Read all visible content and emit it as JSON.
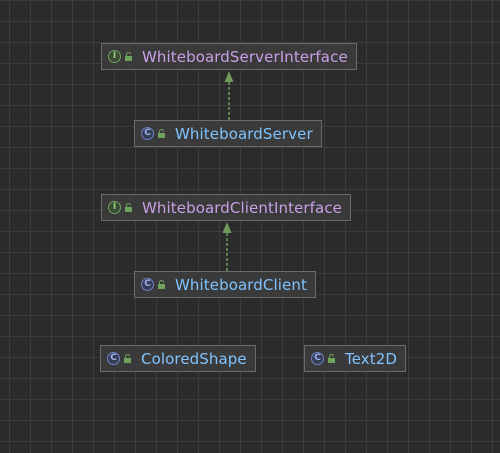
{
  "diagram": {
    "nodes": [
      {
        "id": "WhiteboardServerInterface",
        "kind": "interface",
        "kind_icon": "interface-icon",
        "kind_glyph": "I",
        "label": "WhiteboardServerInterface"
      },
      {
        "id": "WhiteboardServer",
        "kind": "class",
        "kind_icon": "class-icon",
        "kind_glyph": "C",
        "label": "WhiteboardServer"
      },
      {
        "id": "WhiteboardClientInterface",
        "kind": "interface",
        "kind_icon": "interface-icon",
        "kind_glyph": "I",
        "label": "WhiteboardClientInterface"
      },
      {
        "id": "WhiteboardClient",
        "kind": "class",
        "kind_icon": "class-icon",
        "kind_glyph": "C",
        "label": "WhiteboardClient"
      },
      {
        "id": "ColoredShape",
        "kind": "class",
        "kind_icon": "class-icon",
        "kind_glyph": "C",
        "label": "ColoredShape"
      },
      {
        "id": "Text2D",
        "kind": "class",
        "kind_icon": "class-icon",
        "kind_glyph": "C",
        "label": "Text2D"
      }
    ],
    "edges": [
      {
        "from": "WhiteboardServer",
        "to": "WhiteboardServerInterface",
        "type": "implements"
      },
      {
        "from": "WhiteboardClient",
        "to": "WhiteboardClientInterface",
        "type": "implements"
      }
    ],
    "colors": {
      "background": "#2b2b2b",
      "grid": "#3c3c3c",
      "node_fill": "#3a3a3a",
      "node_border": "#6b6b6b",
      "interface_text": "#c8a0e6",
      "class_text": "#7fc3ff",
      "edge": "#6e9a5a"
    }
  }
}
